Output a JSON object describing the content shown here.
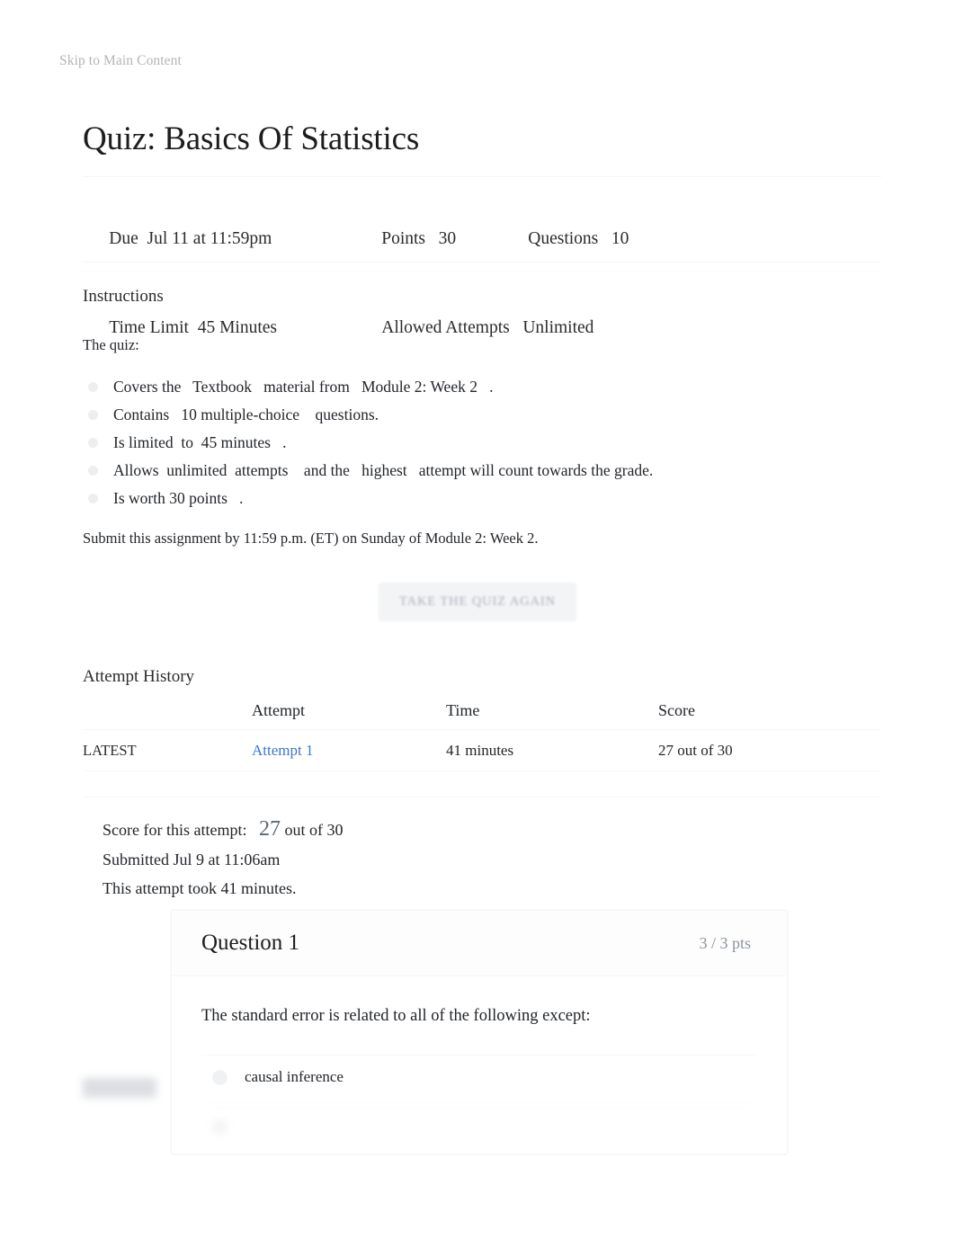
{
  "skip_link": "Skip to Main Content",
  "page_title": "Quiz: Basics Of Statistics",
  "meta": {
    "due_label": "Due",
    "due_value": "Jul 11 at 11:59pm",
    "points_label": "Points",
    "points_value": "30",
    "questions_label": "Questions",
    "questions_value": "10",
    "time_limit_label": "Time Limit",
    "time_limit_value": "45 Minutes",
    "allowed_attempts_label": "Allowed Attempts",
    "allowed_attempts_value": "Unlimited"
  },
  "instructions": {
    "heading": "Instructions",
    "lead": "The quiz:",
    "bullets": [
      "Covers the   Textbook   material from   Module 2: Week 2   .",
      "Contains   10 multiple-choice    questions.",
      "Is limited  to  45 minutes   .",
      "Allows  unlimited  attempts    and the   highest   attempt will count towards the grade.",
      "Is worth 30 points   ."
    ],
    "submit_note": "Submit this assignment by 11:59 p.m. (ET) on Sunday of Module 2: Week 2."
  },
  "retake_button": "TAKE THE QUIZ AGAIN",
  "attempt_history": {
    "heading": "Attempt History",
    "columns": [
      "",
      "Attempt",
      "Time",
      "Score"
    ],
    "rows": [
      {
        "kept": "LATEST",
        "attempt": "Attempt 1",
        "time": "41 minutes",
        "score": "27 out of 30"
      }
    ]
  },
  "score_summary": {
    "score_label": "Score for this attempt:",
    "score_value": "27",
    "score_suffix": "out of 30",
    "submitted": "Submitted Jul 9 at 11:06am",
    "duration": "This attempt took 41 minutes."
  },
  "question": {
    "title": "Question 1",
    "points": "3 / 3 pts",
    "text": "The standard error is related to all of the following except:",
    "answers": [
      {
        "label": "causal inference",
        "blurred": false
      },
      {
        "label": "",
        "blurred": true
      }
    ]
  },
  "colors": {
    "link_blue": "#3a77cc",
    "text": "#22252a",
    "muted": "#8e959c",
    "divider": "#f4f6f7"
  }
}
